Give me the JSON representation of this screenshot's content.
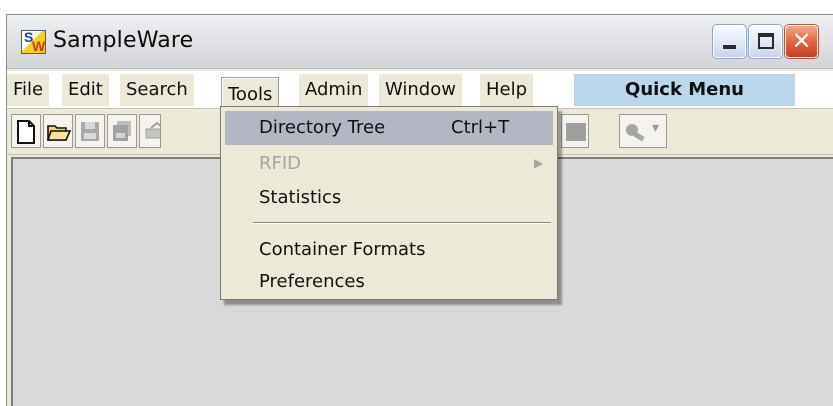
{
  "window": {
    "title": "SampleWare",
    "logo_letters": "SW",
    "controls": {
      "minimize_icon": "minimize-icon",
      "maximize_icon": "maximize-icon",
      "close_icon": "close-icon",
      "close_glyph": "✕"
    }
  },
  "menubar": {
    "items": [
      {
        "label": "File"
      },
      {
        "label": "Edit"
      },
      {
        "label": "Search"
      },
      {
        "label": "Tools",
        "open": true
      },
      {
        "label": "Admin"
      },
      {
        "label": "Window"
      },
      {
        "label": "Help"
      }
    ],
    "quick_menu": "Quick Menu"
  },
  "toolbar": {
    "buttons": [
      {
        "icon": "new-document-icon"
      },
      {
        "icon": "open-folder-icon"
      },
      {
        "icon": "save-icon",
        "disabled": true
      },
      {
        "icon": "save-all-icon",
        "disabled": true
      },
      {
        "icon": "print-icon",
        "disabled": true
      },
      {
        "icon": "disabled-icon",
        "disabled": true
      },
      {
        "icon": "search-dropdown-icon",
        "disabled": true
      }
    ],
    "dropdown_caret": "▾"
  },
  "tools_menu": {
    "items": [
      {
        "label": "Directory Tree",
        "shortcut": "Ctrl+T",
        "highlighted": true
      },
      {
        "label": "RFID",
        "disabled": true,
        "submenu_arrow": "▶"
      },
      {
        "label": "Statistics"
      },
      {
        "separator": true
      },
      {
        "label": "Container Formats"
      },
      {
        "label": "Preferences"
      }
    ]
  },
  "colors": {
    "menu_highlight": "#b5b6c4",
    "quick_menu_bg": "#bcd6ea",
    "content_bg": "#d9d9d9",
    "chrome_bg": "#ece9d8"
  }
}
